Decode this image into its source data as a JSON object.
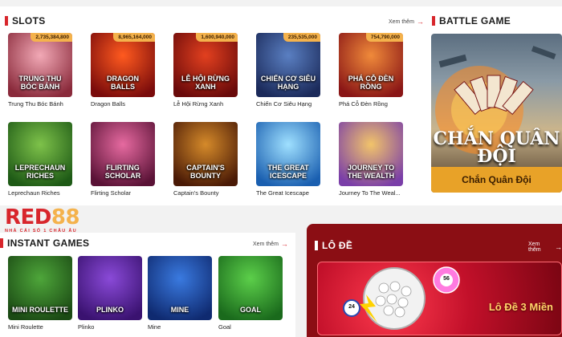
{
  "slots": {
    "title": "SLOTS",
    "more_label": "Xem thêm",
    "games": [
      {
        "name": "Trung Thu Bóc Bánh",
        "art_text": "TRUNG THU BÓC BÁNH",
        "jackpot": "2,735,384,800",
        "bg1": "#f2a9b6",
        "bg2": "#8a2a3b"
      },
      {
        "name": "Dragon Balls",
        "art_text": "DRAGON BALLS",
        "jackpot": "8,965,164,000",
        "bg1": "#ff5a1f",
        "bg2": "#7a0b0b"
      },
      {
        "name": "Lễ Hội Rừng Xanh",
        "art_text": "LỄ HỘI RỪNG XANH",
        "jackpot": "1,600,940,000",
        "bg1": "#e2401f",
        "bg2": "#6a0a0a"
      },
      {
        "name": "Chiến Cơ Siêu Hạng",
        "art_text": "CHIẾN CƠ SIÊU HẠNG",
        "jackpot": "235,535,000",
        "bg1": "#5a7fc2",
        "bg2": "#1b2a5a"
      },
      {
        "name": "Phá Cỗ Đèn Rồng",
        "art_text": "PHÁ CỖ ĐÈN RỒNG",
        "jackpot": "754,790,000",
        "bg1": "#f08a3a",
        "bg2": "#8a1616"
      },
      {
        "name": "Leprechaun Riches",
        "art_text": "LEPRECHAUN RICHES",
        "jackpot": "",
        "bg1": "#7ec24a",
        "bg2": "#1e5a16"
      },
      {
        "name": "Flirting Scholar",
        "art_text": "FLIRTING SCHOLAR",
        "jackpot": "",
        "bg1": "#e66aa0",
        "bg2": "#5a1236"
      },
      {
        "name": "Captain's Bounty",
        "art_text": "CAPTAIN'S BOUNTY",
        "jackpot": "",
        "bg1": "#d58a2a",
        "bg2": "#4a1a06"
      },
      {
        "name": "The Great Icescape",
        "art_text": "THE GREAT ICESCAPE",
        "jackpot": "",
        "bg1": "#9fe0ff",
        "bg2": "#1a5fb0"
      },
      {
        "name": "Journey To The Weal...",
        "art_text": "JOURNEY TO THE WEALTH",
        "jackpot": "",
        "bg1": "#f2c46a",
        "bg2": "#7a3ea8"
      }
    ]
  },
  "battle": {
    "title": "BATTLE GAME",
    "card_art": "CHẮN QUÂN ĐỘI",
    "card_label": "Chắn Quân Đội"
  },
  "brand": {
    "logo_main": "RED",
    "logo_num": "88",
    "tagline": "NHÀ CÁI SỐ 1 CHÂU ÂU"
  },
  "instant": {
    "title": "INSTANT GAMES",
    "more_label": "Xem thêm",
    "games": [
      {
        "name": "Mini Roulette",
        "art_text": "MINI ROULETTE",
        "bg1": "#4ea63a",
        "bg2": "#1b4a14"
      },
      {
        "name": "Plinko",
        "art_text": "PLINKO",
        "bg1": "#8a4ad8",
        "bg2": "#3a1270"
      },
      {
        "name": "Mine",
        "art_text": "MINE",
        "bg1": "#3a7ae0",
        "bg2": "#0f2a70"
      },
      {
        "name": "Goal",
        "art_text": "GOAL",
        "bg1": "#5ccf4a",
        "bg2": "#1a6a1c"
      }
    ]
  },
  "lode": {
    "title": "LÔ ĐỀ",
    "more_label": "Xem thêm",
    "card_label": "Lô Đề 3 Miền",
    "ball_a": "56",
    "ball_b": "24"
  },
  "colors": {
    "accent": "#d8262c",
    "gold": "#e8a228"
  }
}
